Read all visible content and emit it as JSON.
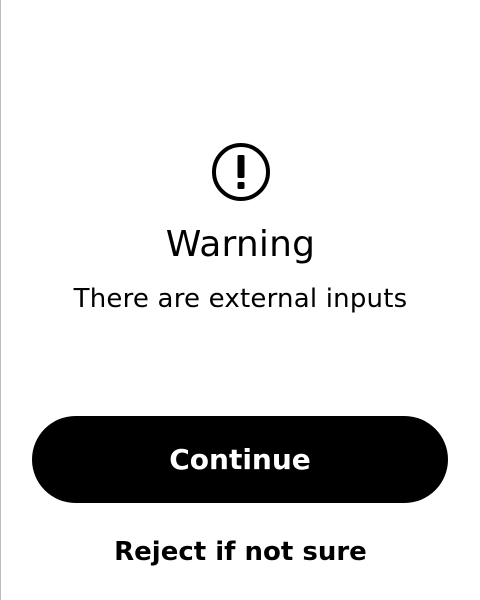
{
  "dialog": {
    "icon": "warning-circle-icon",
    "title": "Warning",
    "message": "There are external inputs",
    "primary_action_label": "Continue",
    "secondary_action_label": "Reject if not sure"
  },
  "colors": {
    "background": "#ffffff",
    "text": "#000000",
    "primary_button_background": "#000000",
    "primary_button_text": "#ffffff"
  }
}
